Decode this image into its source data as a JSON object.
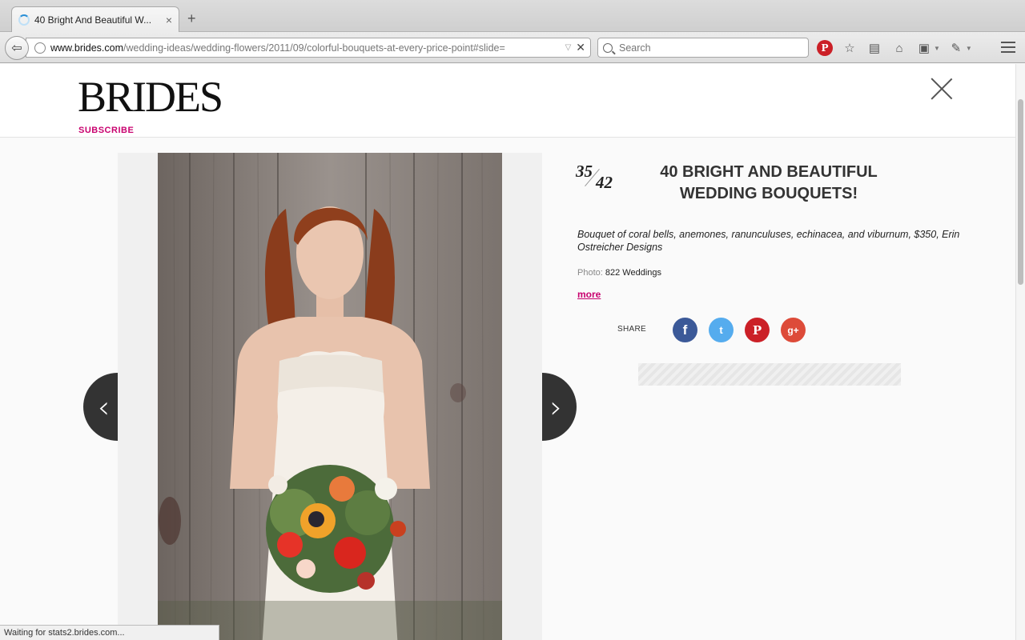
{
  "browser": {
    "tab": {
      "title": "40 Bright And Beautiful W...",
      "close": "×"
    },
    "new_tab": "+",
    "url": {
      "host": "www.brides.com",
      "path": "/wedding-ideas/wedding-flowers/2011/09/colorful-bouquets-at-every-price-point#slide="
    },
    "search": {
      "placeholder": "Search"
    },
    "status": "Waiting for stats2.brides.com..."
  },
  "header": {
    "logo": "BRIDES",
    "subscribe": "SUBSCRIBE"
  },
  "slideshow": {
    "current": "35",
    "total": "42",
    "title": "40 BRIGHT AND BEAUTIFUL WEDDING BOUQUETS!",
    "caption": "Bouquet of coral bells, anemones, ranunculuses, echinacea, and viburnum, $350, Erin Ostreicher Designs",
    "photo_label": "Photo:",
    "photo_credit": "822 Weddings",
    "more": "more",
    "prev": "‹",
    "next": "›"
  },
  "share": {
    "label": "SHARE",
    "facebook": "f",
    "twitter": "t",
    "pinterest": "P",
    "googleplus": "g+"
  },
  "colors": {
    "accent": "#c8006e",
    "facebook": "#3b5998",
    "twitter": "#55acee",
    "pinterest": "#cb2027",
    "googleplus": "#dd4b39"
  }
}
